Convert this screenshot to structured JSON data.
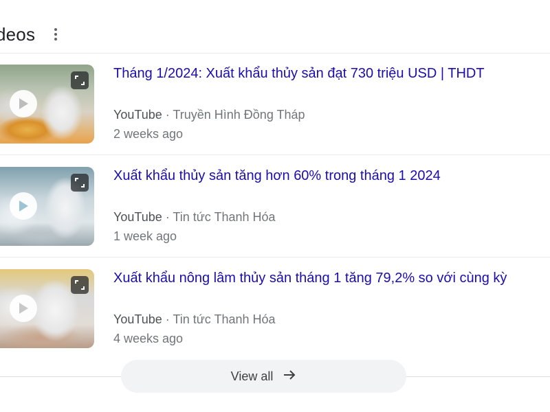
{
  "section": {
    "title": "ideos",
    "more_icon": "more-vert-icon"
  },
  "videos": [
    {
      "title": "Tháng 1/2024: Xuất khẩu thủy sản đạt 730 triệu USD | THDT",
      "platform": "YouTube",
      "separator": "·",
      "channel": "Truyền Hình Đồng Tháp",
      "date": "2 weeks ago"
    },
    {
      "title": "Xuất khẩu thủy sản tăng hơn 60% trong tháng 1 2024",
      "platform": "YouTube",
      "separator": "·",
      "channel": "Tin tức Thanh Hóa",
      "date": "1 week ago"
    },
    {
      "title": "Xuất khẩu nông lâm thủy sản tháng 1 tăng 79,2% so với cùng kỳ",
      "platform": "YouTube",
      "separator": "·",
      "channel": "Tin tức Thanh Hóa",
      "date": "4 weeks ago"
    }
  ],
  "view_all": {
    "label": "View all",
    "icon": "arrow-right-icon"
  },
  "colors": {
    "link": "#1a0dab",
    "text": "#202124",
    "secondary": "#70757a",
    "button_bg": "#f1f3f4"
  }
}
